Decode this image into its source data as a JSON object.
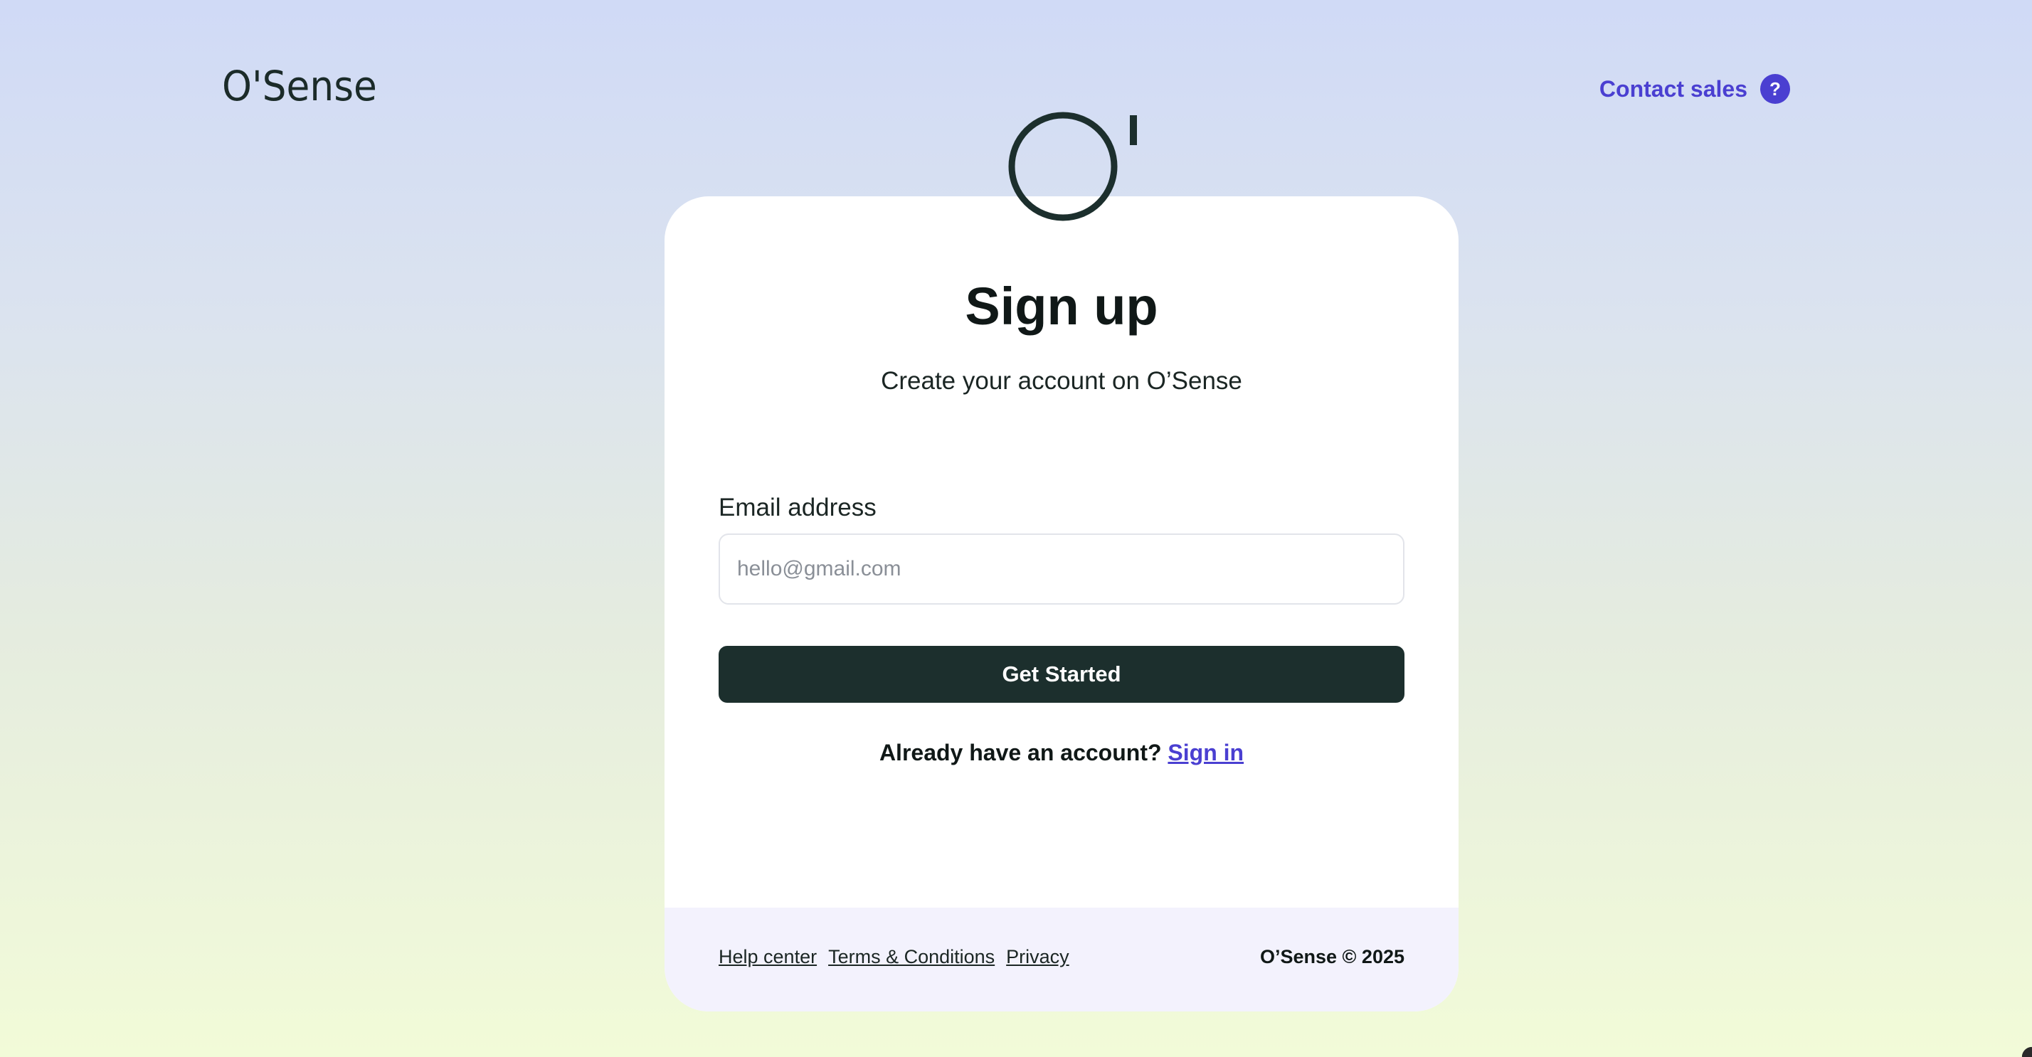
{
  "header": {
    "brand": "O'Sense",
    "contact_label": "Contact sales",
    "help_icon_glyph": "?"
  },
  "card": {
    "title": "Sign up",
    "subtitle": "Create your account on O’Sense",
    "email": {
      "label": "Email address",
      "placeholder": "hello@gmail.com",
      "value": ""
    },
    "submit_label": "Get Started",
    "signin_prompt": "Already have an account?",
    "signin_link": "Sign in"
  },
  "footer": {
    "links": [
      "Help center",
      "Terms & Conditions",
      "Privacy"
    ],
    "copyright": "O’Sense © 2025"
  },
  "icons": {
    "emblem": "brand-emblem-icon",
    "help": "question-icon"
  },
  "colors": {
    "accent": "#4a3fd1",
    "primary_button": "#1c2f2d",
    "footer_bg": "#f3f2fd",
    "dark_text": "#101817"
  }
}
